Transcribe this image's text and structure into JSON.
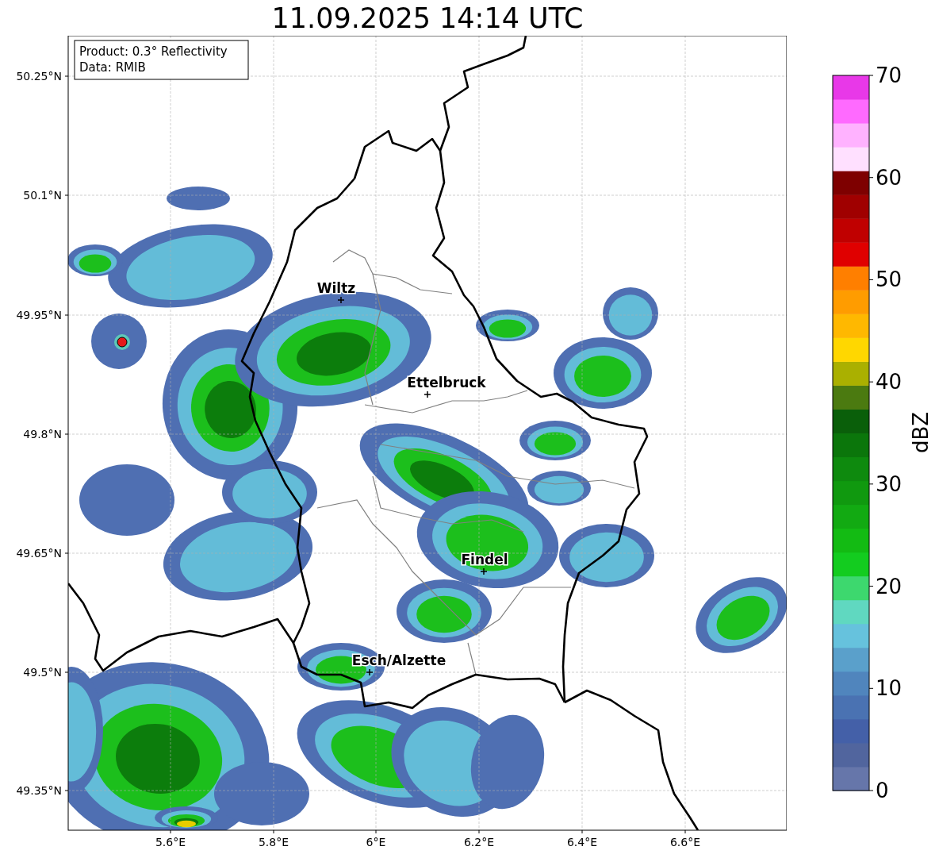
{
  "title": "11.09.2025 14:14 UTC",
  "info_box": {
    "lines": [
      "Product: 0.3° Reflectivity",
      "Data: RMIB"
    ]
  },
  "cities": [
    {
      "name": "Wiltz"
    },
    {
      "name": "Ettelbruck"
    },
    {
      "name": "Findel"
    },
    {
      "name": "Esch/Alzette"
    }
  ],
  "y_ticks": [
    "50.25°N",
    "50.1°N",
    "49.95°N",
    "49.8°N",
    "49.65°N",
    "49.5°N",
    "49.35°N"
  ],
  "x_ticks": [
    "5.6°E",
    "5.8°E",
    "6°E",
    "6.2°E",
    "6.4°E",
    "6.6°E"
  ],
  "colorbar": {
    "label": "dBZ",
    "ticks": [
      "70",
      "60",
      "50",
      "40",
      "30",
      "20",
      "10",
      "0"
    ]
  }
}
